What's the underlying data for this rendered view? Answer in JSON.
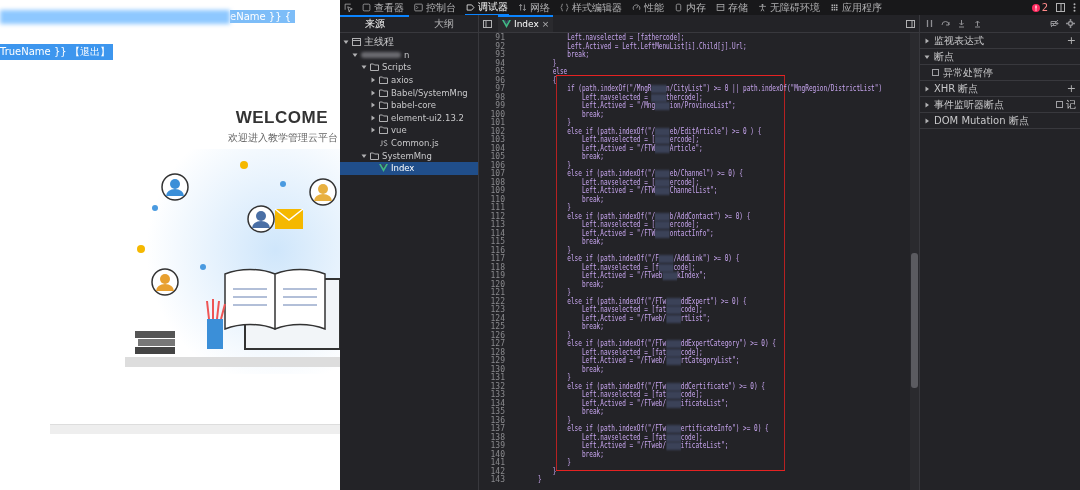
{
  "webpage": {
    "header_fragment": "eName }} {",
    "user_line": "TrueName }} 【退出】",
    "welcome_title": "WELCOME",
    "welcome_subtitle": "欢迎进入教学管理云平台"
  },
  "devtools": {
    "tools": [
      {
        "label": "查看器",
        "selected": false
      },
      {
        "label": "控制台",
        "selected": false
      },
      {
        "label": "调试器",
        "selected": true
      },
      {
        "label": "网络",
        "selected": false
      },
      {
        "label": "样式编辑器",
        "selected": false
      },
      {
        "label": "性能",
        "selected": false
      },
      {
        "label": "内存",
        "selected": false
      },
      {
        "label": "存储",
        "selected": false
      },
      {
        "label": "无障碍环境",
        "selected": false
      },
      {
        "label": "应用程序",
        "selected": false
      }
    ],
    "error_count": "2",
    "source_tabs": [
      {
        "label": "来源",
        "selected": true
      },
      {
        "label": "大纲",
        "selected": false
      }
    ],
    "file_tree": [
      {
        "kind": "thread",
        "label": "主线程",
        "expanded": true,
        "selected": false,
        "children": [
          {
            "kind": "domain",
            "label": "n",
            "expanded": true,
            "selected": false,
            "children": [
              {
                "kind": "folder",
                "label": "Scripts",
                "expanded": true,
                "selected": false,
                "children": [
                  {
                    "kind": "folder",
                    "label": "axios",
                    "expanded": false,
                    "selected": false
                  },
                  {
                    "kind": "folder",
                    "label": "Babel/SystemMng",
                    "expanded": false,
                    "selected": false
                  },
                  {
                    "kind": "folder",
                    "label": "babel-core",
                    "expanded": false,
                    "selected": false
                  },
                  {
                    "kind": "folder",
                    "label": "element-ui2.13.2",
                    "expanded": false,
                    "selected": false
                  },
                  {
                    "kind": "folder",
                    "label": "vue",
                    "expanded": false,
                    "selected": false
                  },
                  {
                    "kind": "js",
                    "label": "Common.js",
                    "selected": false
                  }
                ]
              },
              {
                "kind": "folder",
                "label": "SystemMng",
                "expanded": true,
                "selected": false,
                "children": [
                  {
                    "kind": "vue",
                    "label": "Index",
                    "selected": true
                  }
                ]
              }
            ]
          }
        ]
      }
    ],
    "editor_tab": {
      "label": "Index",
      "close": "×"
    },
    "code": {
      "lines_before": [
        {
          "number": "91",
          "parts": [
            {
              "kind": "code",
              "text": "        Left.navselected = [fathercode];"
            }
          ]
        },
        {
          "number": "92",
          "parts": [
            {
              "kind": "code",
              "text": "        Left.Actived = Left.LeftMenuList[i].Child[j].Url;"
            }
          ]
        },
        {
          "number": "93",
          "parts": [
            {
              "kind": "code",
              "text": "        break;"
            }
          ]
        },
        {
          "number": "94",
          "parts": [
            {
              "kind": "code",
              "text": "    }"
            }
          ]
        },
        {
          "number": "95",
          "parts": [
            {
              "kind": "code",
              "text": "    else"
            }
          ]
        }
      ],
      "boxed_lines": [
        {
          "number": "96",
          "parts": [
            {
              "kind": "code",
              "text": "    {"
            }
          ]
        },
        {
          "number": "97",
          "parts": [
            {
              "kind": "code",
              "text": "        if (path.indexOf(\"/MngR"
            },
            {
              "kind": "redacted"
            },
            {
              "kind": "code",
              "text": "n/CityList\") >= 0 || path.indexOf(\"MngRegion/DistrictList\")"
            }
          ]
        },
        {
          "number": "98",
          "parts": [
            {
              "kind": "code",
              "text": "            Left.navselected = "
            },
            {
              "kind": "redacted"
            },
            {
              "kind": "code",
              "text": "thercode];"
            }
          ]
        },
        {
          "number": "99",
          "parts": [
            {
              "kind": "code",
              "text": "            Left.Actived = \"/Mng"
            },
            {
              "kind": "redacted"
            },
            {
              "kind": "code",
              "text": "ion/ProvinceList\";"
            }
          ]
        },
        {
          "number": "100",
          "parts": [
            {
              "kind": "code",
              "text": "            break;"
            }
          ]
        },
        {
          "number": "101",
          "parts": [
            {
              "kind": "code",
              "text": "        }"
            }
          ]
        },
        {
          "number": "102",
          "parts": [
            {
              "kind": "code",
              "text": "        else if (path.indexOf(\"/"
            },
            {
              "kind": "redacted"
            },
            {
              "kind": "code",
              "text": "eb/EditArticle\") >= 0 ) {"
            }
          ]
        },
        {
          "number": "103",
          "parts": [
            {
              "kind": "code",
              "text": "            Left.navselected = ["
            },
            {
              "kind": "redacted"
            },
            {
              "kind": "code",
              "text": "ercode];"
            }
          ]
        },
        {
          "number": "104",
          "parts": [
            {
              "kind": "code",
              "text": "            Left.Actived = \"/FTW"
            },
            {
              "kind": "redacted"
            },
            {
              "kind": "code",
              "text": "Article\";"
            }
          ]
        },
        {
          "number": "105",
          "parts": [
            {
              "kind": "code",
              "text": "            break;"
            }
          ]
        },
        {
          "number": "106",
          "parts": [
            {
              "kind": "code",
              "text": "        }"
            }
          ]
        },
        {
          "number": "107",
          "parts": [
            {
              "kind": "code",
              "text": "        else if (path.indexOf(\"/"
            },
            {
              "kind": "redacted"
            },
            {
              "kind": "code",
              "text": "eb/Channel\") >= 0) {"
            }
          ]
        },
        {
          "number": "108",
          "parts": [
            {
              "kind": "code",
              "text": "            Left.navselected = ["
            },
            {
              "kind": "redacted"
            },
            {
              "kind": "code",
              "text": "ercode];"
            }
          ]
        },
        {
          "number": "109",
          "parts": [
            {
              "kind": "code",
              "text": "            Left.Actived = \"/FTW"
            },
            {
              "kind": "redacted"
            },
            {
              "kind": "code",
              "text": "ChannelList\";"
            }
          ]
        },
        {
          "number": "110",
          "parts": [
            {
              "kind": "code",
              "text": "            break;"
            }
          ]
        },
        {
          "number": "111",
          "parts": [
            {
              "kind": "code",
              "text": "        }"
            }
          ]
        },
        {
          "number": "112",
          "parts": [
            {
              "kind": "code",
              "text": "        else if (path.indexOf(\"/"
            },
            {
              "kind": "redacted"
            },
            {
              "kind": "code",
              "text": "b/AddContact\") >= 0) {"
            }
          ]
        },
        {
          "number": "113",
          "parts": [
            {
              "kind": "code",
              "text": "            Left.navselected = ["
            },
            {
              "kind": "redacted"
            },
            {
              "kind": "code",
              "text": "ercode];"
            }
          ]
        },
        {
          "number": "114",
          "parts": [
            {
              "kind": "code",
              "text": "            Left.Actived = \"/FTW"
            },
            {
              "kind": "redacted"
            },
            {
              "kind": "code",
              "text": "ontactInfo\";"
            }
          ]
        },
        {
          "number": "115",
          "parts": [
            {
              "kind": "code",
              "text": "            break;"
            }
          ]
        },
        {
          "number": "116",
          "parts": [
            {
              "kind": "code",
              "text": "        }"
            }
          ]
        },
        {
          "number": "117",
          "parts": [
            {
              "kind": "code",
              "text": "        else if (path.indexOf(\"/F"
            },
            {
              "kind": "redacted"
            },
            {
              "kind": "code",
              "text": "/AddLink\") >= 0) {"
            }
          ]
        },
        {
          "number": "118",
          "parts": [
            {
              "kind": "code",
              "text": "            Left.navselected = [f"
            },
            {
              "kind": "redacted"
            },
            {
              "kind": "code",
              "text": "code];"
            }
          ]
        },
        {
          "number": "119",
          "parts": [
            {
              "kind": "code",
              "text": "            Left.Actived = \"/FTweb"
            },
            {
              "kind": "redacted"
            },
            {
              "kind": "code",
              "text": "kIndex\";"
            }
          ]
        },
        {
          "number": "120",
          "parts": [
            {
              "kind": "code",
              "text": "            break;"
            }
          ]
        },
        {
          "number": "121",
          "parts": [
            {
              "kind": "code",
              "text": "        }"
            }
          ]
        },
        {
          "number": "122",
          "parts": [
            {
              "kind": "code",
              "text": "        else if (path.indexOf(\"/FTw"
            },
            {
              "kind": "redacted"
            },
            {
              "kind": "code",
              "text": "ddExpert\") >= 0) {"
            }
          ]
        },
        {
          "number": "123",
          "parts": [
            {
              "kind": "code",
              "text": "            Left.navselected = [fat"
            },
            {
              "kind": "redacted"
            },
            {
              "kind": "code",
              "text": "code];"
            }
          ]
        },
        {
          "number": "124",
          "parts": [
            {
              "kind": "code",
              "text": "            Left.Actived = \"/FTweb/"
            },
            {
              "kind": "redacted"
            },
            {
              "kind": "code",
              "text": "rtList\";"
            }
          ]
        },
        {
          "number": "125",
          "parts": [
            {
              "kind": "code",
              "text": "            break;"
            }
          ]
        },
        {
          "number": "126",
          "parts": [
            {
              "kind": "code",
              "text": "        }"
            }
          ]
        },
        {
          "number": "127",
          "parts": [
            {
              "kind": "code",
              "text": "        else if (path.indexOf(\"/FTw"
            },
            {
              "kind": "redacted"
            },
            {
              "kind": "code",
              "text": "ddExpertCategory\") >= 0) {"
            }
          ]
        },
        {
          "number": "128",
          "parts": [
            {
              "kind": "code",
              "text": "            Left.navselected = [fat"
            },
            {
              "kind": "redacted"
            },
            {
              "kind": "code",
              "text": "code];"
            }
          ]
        },
        {
          "number": "129",
          "parts": [
            {
              "kind": "code",
              "text": "            Left.Actived = \"/FTweb/"
            },
            {
              "kind": "redacted"
            },
            {
              "kind": "code",
              "text": "rtCategoryList\";"
            }
          ]
        },
        {
          "number": "130",
          "parts": [
            {
              "kind": "code",
              "text": "            break;"
            }
          ]
        },
        {
          "number": "131",
          "parts": [
            {
              "kind": "code",
              "text": "        }"
            }
          ]
        },
        {
          "number": "132",
          "parts": [
            {
              "kind": "code",
              "text": "        else if (path.indexOf(\"/FTw"
            },
            {
              "kind": "redacted"
            },
            {
              "kind": "code",
              "text": "ddCertificate\") >= 0) {"
            }
          ]
        },
        {
          "number": "133",
          "parts": [
            {
              "kind": "code",
              "text": "            Left.navselected = [fat"
            },
            {
              "kind": "redacted"
            },
            {
              "kind": "code",
              "text": "code];"
            }
          ]
        },
        {
          "number": "134",
          "parts": [
            {
              "kind": "code",
              "text": "            Left.Actived = \"/FTweb/"
            },
            {
              "kind": "redacted"
            },
            {
              "kind": "code",
              "text": "ificateList\";"
            }
          ]
        },
        {
          "number": "135",
          "parts": [
            {
              "kind": "code",
              "text": "            break;"
            }
          ]
        },
        {
          "number": "136",
          "parts": [
            {
              "kind": "code",
              "text": "        }"
            }
          ]
        },
        {
          "number": "137",
          "parts": [
            {
              "kind": "code",
              "text": "        else if (path.indexOf(\"/FTw"
            },
            {
              "kind": "redacted"
            },
            {
              "kind": "code",
              "text": "ertificateInfo\") >= 0) {"
            }
          ]
        },
        {
          "number": "138",
          "parts": [
            {
              "kind": "code",
              "text": "            Left.navselected = [fat"
            },
            {
              "kind": "redacted"
            },
            {
              "kind": "code",
              "text": "code];"
            }
          ]
        },
        {
          "number": "139",
          "parts": [
            {
              "kind": "code",
              "text": "            Left.Actived = \"/FTweb/"
            },
            {
              "kind": "redacted"
            },
            {
              "kind": "code",
              "text": "ificateList\";"
            }
          ]
        },
        {
          "number": "140",
          "parts": [
            {
              "kind": "code",
              "text": "            break;"
            }
          ]
        },
        {
          "number": "141",
          "parts": [
            {
              "kind": "code",
              "text": "        }"
            }
          ]
        }
      ],
      "lines_after": [
        {
          "number": "142",
          "parts": [
            {
              "kind": "code",
              "text": "    }"
            }
          ]
        },
        {
          "number": "143",
          "parts": [
            {
              "kind": "code",
              "text": "}"
            }
          ]
        }
      ]
    },
    "panes": [
      {
        "label": "监视表达式",
        "expanded": false,
        "action": "+"
      },
      {
        "label": "断点",
        "expanded": true,
        "options": [
          {
            "label": "异常处暂停",
            "checked": false
          }
        ]
      },
      {
        "label": "XHR 断点",
        "expanded": false,
        "action": "+"
      },
      {
        "label": "事件监听器断点",
        "expanded": false,
        "toggle": {
          "label": "记",
          "checked": false
        }
      },
      {
        "label": "DOM Mutation 断点",
        "expanded": false
      }
    ]
  }
}
